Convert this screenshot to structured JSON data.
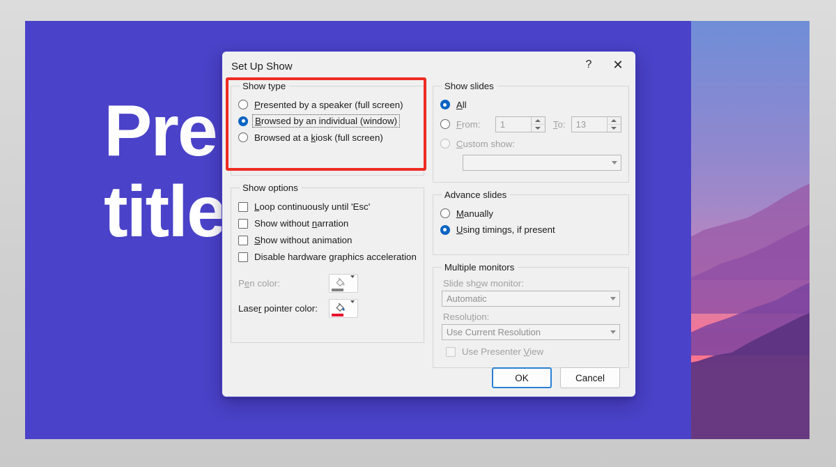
{
  "slide": {
    "title_line1": "Pre",
    "title_line2": "title",
    "bg_color": "#4a42c8"
  },
  "dialog": {
    "title": "Set Up Show",
    "help_icon": "?",
    "close_icon": "✕",
    "annotation_color": "#ee2b23"
  },
  "show_type": {
    "legend": "Show type",
    "options": [
      {
        "label": "Presented by a speaker (full screen)",
        "selected": false,
        "disabled": false
      },
      {
        "label": "Browsed by an individual (window)",
        "selected": true,
        "disabled": false,
        "focused": true
      },
      {
        "label": "Browsed at a kiosk (full screen)",
        "selected": false,
        "disabled": false
      }
    ]
  },
  "show_options": {
    "legend": "Show options",
    "checkboxes": [
      {
        "label": "Loop continuously until 'Esc'",
        "checked": false,
        "disabled": false
      },
      {
        "label": "Show without narration",
        "checked": false,
        "disabled": false
      },
      {
        "label": "Show without animation",
        "checked": false,
        "disabled": false
      },
      {
        "label": "Disable hardware graphics acceleration",
        "checked": false,
        "disabled": false
      }
    ],
    "pen_color_label": "Pen color:",
    "pen_color_value": "#808080",
    "pen_color_disabled": true,
    "laser_color_label": "Laser pointer color:",
    "laser_color_value": "#e8112d",
    "laser_color_disabled": false
  },
  "show_slides": {
    "legend": "Show slides",
    "all_label": "All",
    "all_selected": true,
    "from_label": "From:",
    "from_value": "1",
    "to_label": "To:",
    "to_value": "13",
    "range_selected": false,
    "range_disabled": true,
    "custom_show_label": "Custom show:",
    "custom_show_selected": false,
    "custom_show_disabled": true,
    "custom_show_value": ""
  },
  "advance_slides": {
    "legend": "Advance slides",
    "options": [
      {
        "label": "Manually",
        "selected": false
      },
      {
        "label": "Using timings, if present",
        "selected": true
      }
    ]
  },
  "multiple_monitors": {
    "legend": "Multiple monitors",
    "monitor_label": "Slide show monitor:",
    "monitor_value": "Automatic",
    "resolution_label": "Resolution:",
    "resolution_value": "Use Current Resolution",
    "presenter_view_label": "Use Presenter View",
    "presenter_view_checked": false,
    "disabled": true
  },
  "footer": {
    "ok_label": "OK",
    "cancel_label": "Cancel"
  }
}
